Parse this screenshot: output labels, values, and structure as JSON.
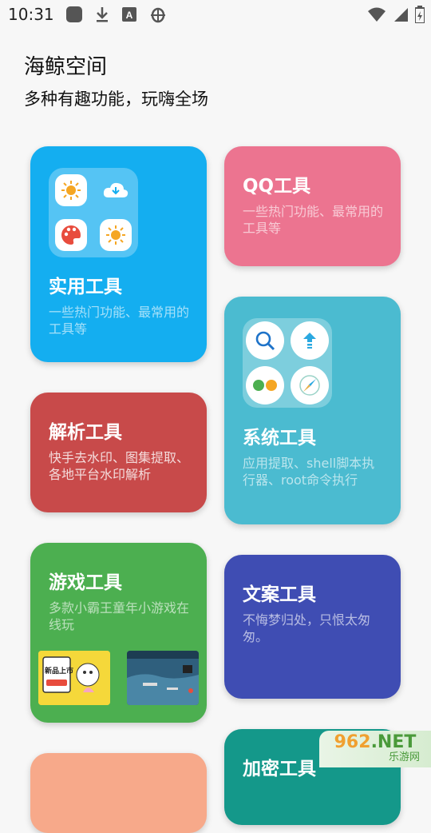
{
  "status_bar": {
    "time": "10:31",
    "icons": [
      "square-icon",
      "download-icon",
      "a-icon",
      "bug-icon",
      "wifi-icon",
      "signal-icon",
      "battery-icon"
    ]
  },
  "header": {
    "title": "海鲸空间",
    "subtitle": "多种有趣功能，玩嗨全场"
  },
  "cards": {
    "practical": {
      "title": "实用工具",
      "desc": "一些热门功能、最常用的工具等",
      "color": "#14aef0"
    },
    "qq": {
      "title": "QQ工具",
      "desc": "一些热门功能、最常用的工具等",
      "color": "#ec7490"
    },
    "system": {
      "title": "系统工具",
      "desc": "应用提取、shell脚本执行器、root命令执行",
      "color": "#4bbbd0"
    },
    "parse": {
      "title": "解析工具",
      "desc": "快手去水印、图集提取、各地平台水印解析",
      "color": "#c84a4a"
    },
    "game": {
      "title": "游戏工具",
      "desc": "多款小霸王童年小游戏在线玩",
      "color": "#4caf50",
      "thumb1_text": "新品上市"
    },
    "copy": {
      "title": "文案工具",
      "desc": "不悔梦归处，只恨太匆匆。",
      "color": "#3f4db3"
    },
    "encrypt": {
      "title": "加密工具",
      "color": "#14988a"
    },
    "extra": {
      "color": "#f7a98a"
    }
  },
  "watermark": {
    "number": "962",
    "suffix": ".NET",
    "site": "乐游网"
  }
}
